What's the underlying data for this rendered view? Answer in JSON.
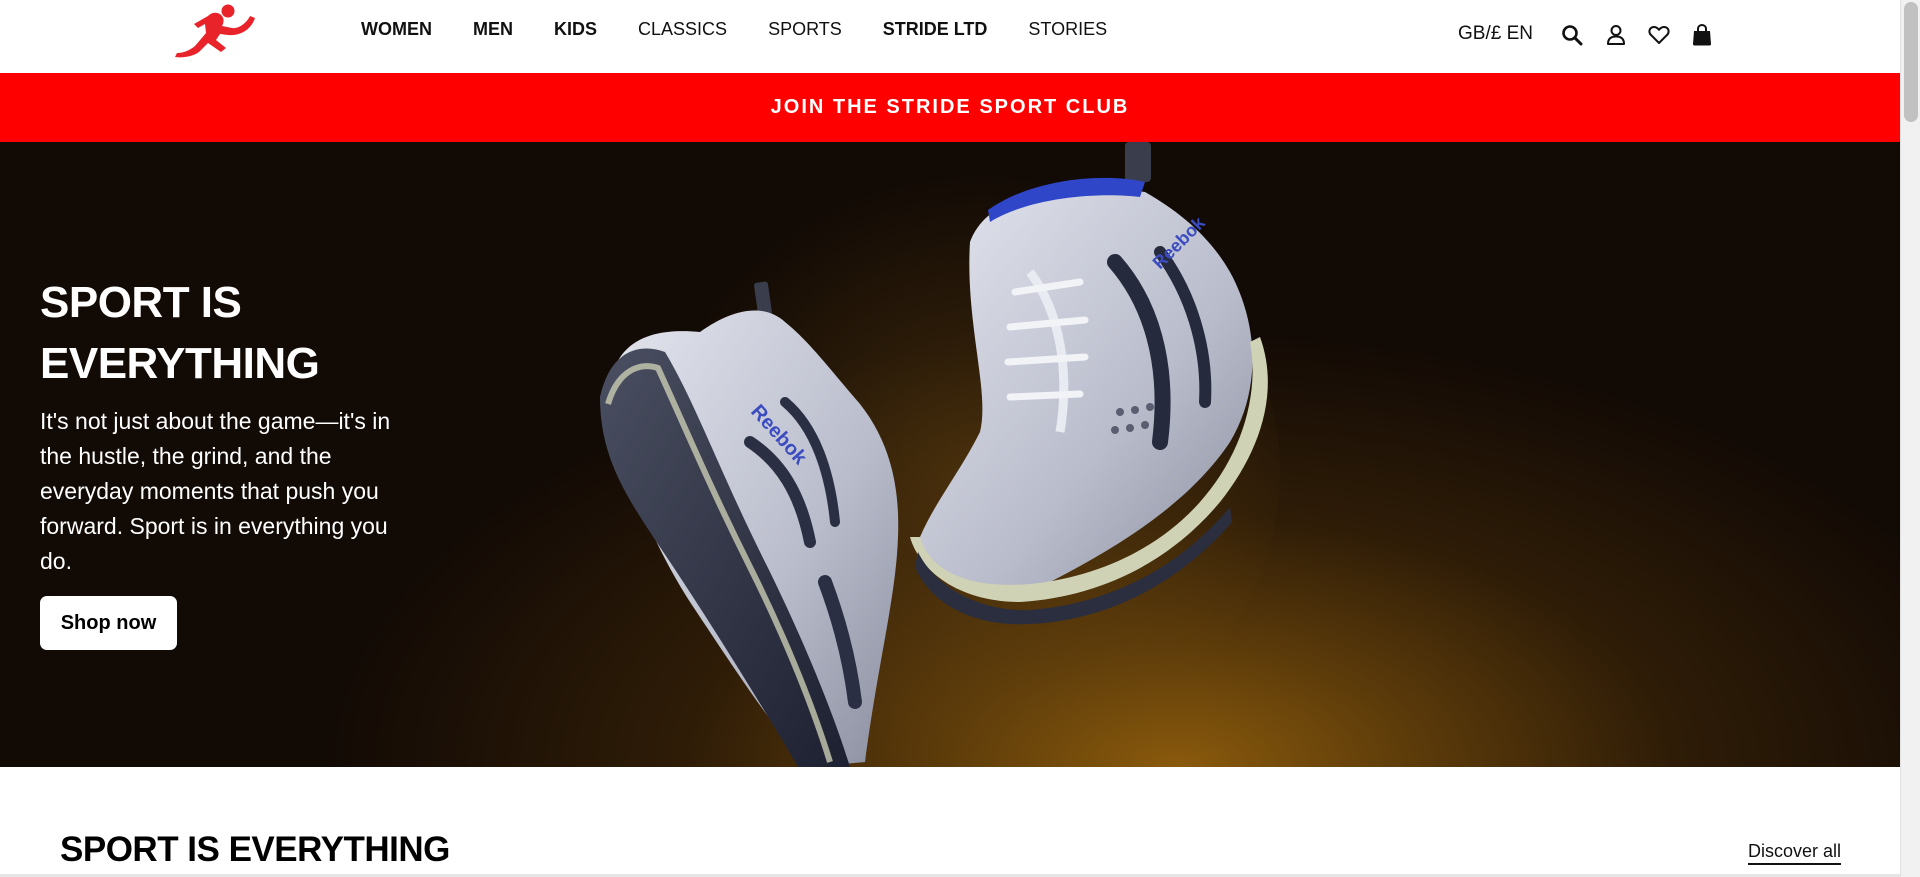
{
  "header": {
    "logo_icon": "running-figure-logo",
    "nav": [
      {
        "label": "WOMEN",
        "bold": true
      },
      {
        "label": "MEN",
        "bold": true
      },
      {
        "label": "KIDS",
        "bold": true
      },
      {
        "label": "CLASSICS",
        "bold": false
      },
      {
        "label": "SPORTS",
        "bold": false
      },
      {
        "label": "STRIDE LTD",
        "bold": true
      },
      {
        "label": "STORIES",
        "bold": false
      }
    ],
    "locale": "GB/£ EN",
    "icons": [
      "search-icon",
      "account-icon",
      "wishlist-icon",
      "bag-icon"
    ]
  },
  "promo": {
    "label": "JOIN THE STRIDE SPORT CLUB"
  },
  "hero": {
    "title": "SPORT IS EVERYTHING",
    "text": "It's not just about the game—it's in the hustle, the grind, and the everyday moments that push you forward. Sport is in everything you do.",
    "button_label": "Shop now",
    "shoe_brand": "Reebok"
  },
  "section": {
    "title": "SPORT IS EVERYTHING",
    "link_label": "Discover all"
  },
  "colors": {
    "accent": "#ff0000",
    "hero_dark": "#120a05",
    "hero_glow": "#8a5a0c",
    "text": "#111111"
  }
}
